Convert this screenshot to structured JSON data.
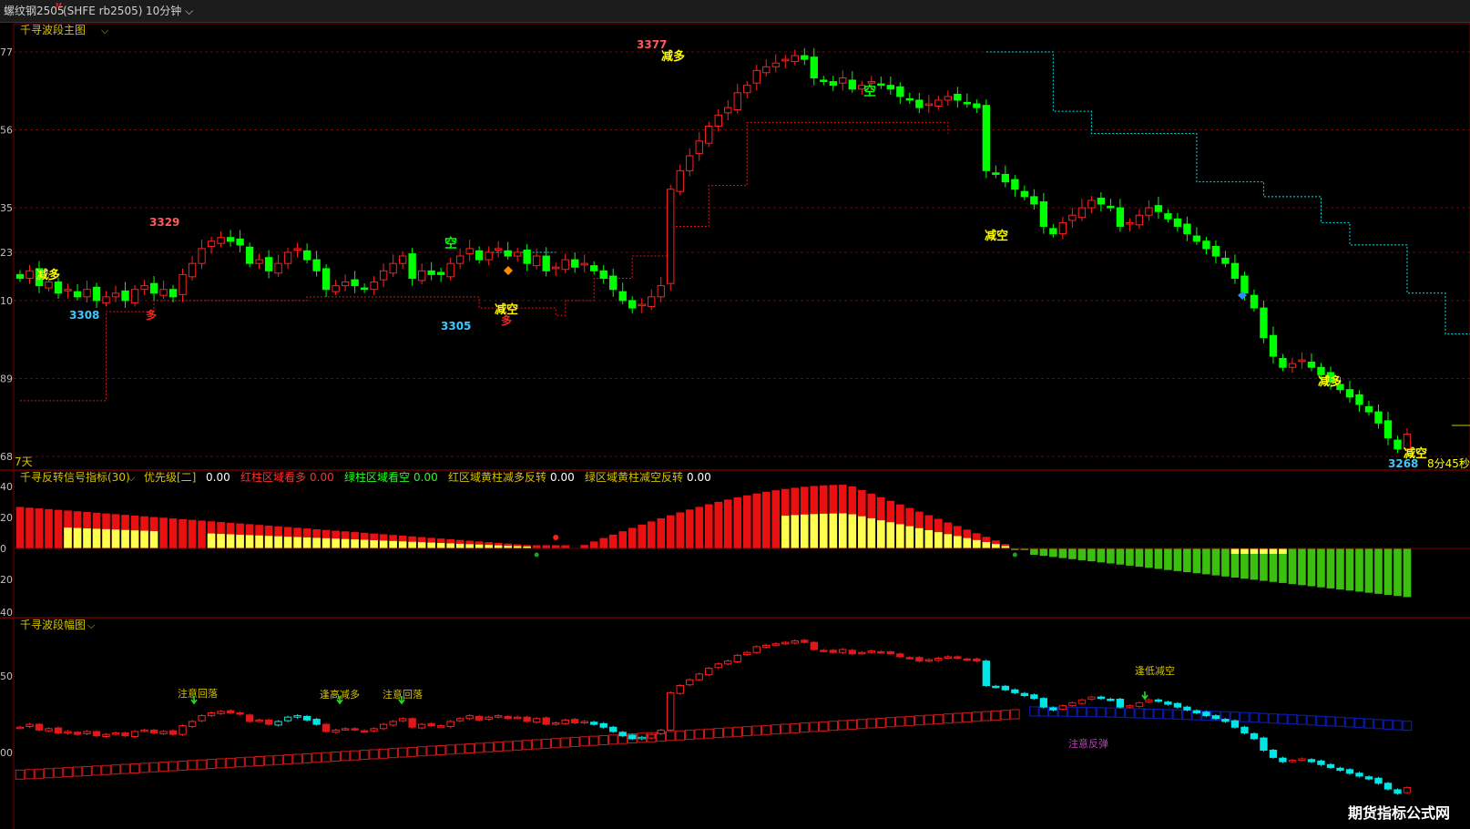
{
  "header": {
    "symbol": "螺纹钢2505",
    "symbol_mark": "M",
    "code": "(SHFE rb2505)",
    "period": "10分钟"
  },
  "colors": {
    "up": "#ff2020",
    "down": "#00ff00",
    "cyan": "#00e6e6",
    "yellow": "#ffff40",
    "navy": "#0a1aa8",
    "axis": "#c0c0c0",
    "grid": "#7a0000"
  },
  "main_panel": {
    "title": "千寻波段主图",
    "y_ticks": [
      "77",
      "56",
      "35",
      "23",
      "10",
      "89",
      "68"
    ],
    "y_ticks_values": [
      3377,
      3356,
      3335,
      3323,
      3310,
      3289,
      3268
    ],
    "days_label": "7天",
    "countdown": "8分45秒",
    "high_labels": [
      "3329",
      "3377"
    ],
    "low_labels": [
      "3308",
      "3305",
      "3268"
    ],
    "signals": {
      "reduce_long": "减多",
      "reduce_short": "减空",
      "long": "多",
      "short": "空"
    }
  },
  "indicator_panel": {
    "title": "千寻反转信号指标(30)",
    "legend": [
      {
        "label": "优先级[二]",
        "value": "0.00"
      },
      {
        "label": "红柱区域看多",
        "value": "0.00"
      },
      {
        "label": "绿柱区域看空",
        "value": "0.00"
      },
      {
        "label": "红区域黄柱减多反转",
        "value": "0.00"
      },
      {
        "label": "绿区域黄柱减空反转",
        "value": "0.00"
      }
    ],
    "y_ticks": [
      "40",
      "20",
      "0",
      "20",
      "40"
    ]
  },
  "amplitude_panel": {
    "title": "千寻波段幅图",
    "y_ticks": [
      "50",
      "00"
    ],
    "annotations": [
      "注意回落",
      "逢高减多",
      "注意回落",
      "逢低减空",
      "注意反弹"
    ]
  },
  "watermark": "期货指标公式网",
  "chart_data": {
    "type": "candlestick",
    "title": "螺纹钢2505 10分钟",
    "ylim": [
      3266,
      3380
    ],
    "marked_extremes": [
      {
        "label": "3329",
        "kind": "high"
      },
      {
        "label": "3377",
        "kind": "high"
      },
      {
        "label": "3308",
        "kind": "low"
      },
      {
        "label": "3305",
        "kind": "low"
      },
      {
        "label": "3268",
        "kind": "low"
      }
    ],
    "close": [
      3316,
      3318,
      3314,
      3315,
      3312,
      3313,
      3311,
      3313,
      3310,
      3311,
      3312,
      3310,
      3313,
      3314,
      3312,
      3313,
      3311,
      3317,
      3320,
      3324,
      3326,
      3327,
      3326,
      3325,
      3320,
      3321,
      3318,
      3320,
      3323,
      3324,
      3321,
      3318,
      3313,
      3314,
      3315,
      3314,
      3313,
      3315,
      3318,
      3320,
      3322,
      3316,
      3318,
      3317,
      3317,
      3320,
      3322,
      3324,
      3321,
      3323,
      3324,
      3322,
      3323,
      3320,
      3322,
      3318,
      3319,
      3321,
      3319,
      3320,
      3318,
      3316,
      3313,
      3310,
      3308,
      3309,
      3311,
      3314,
      3340,
      3345,
      3349,
      3353,
      3357,
      3360,
      3362,
      3366,
      3368,
      3372,
      3373,
      3374,
      3375,
      3376,
      3375,
      3370,
      3369,
      3368,
      3370,
      3367,
      3368,
      3369,
      3368,
      3367,
      3365,
      3364,
      3362,
      3363,
      3364,
      3365,
      3364,
      3363,
      3362,
      3345,
      3344,
      3342,
      3340,
      3338,
      3336,
      3330,
      3328,
      3331,
      3333,
      3335,
      3337,
      3336,
      3335,
      3330,
      3331,
      3333,
      3335,
      3334,
      3332,
      3330,
      3328,
      3326,
      3324,
      3322,
      3320,
      3316,
      3312,
      3308,
      3300,
      3295,
      3292,
      3293,
      3294,
      3292,
      3290,
      3288,
      3286,
      3284,
      3282,
      3280,
      3277,
      3273,
      3270,
      3274
    ]
  }
}
